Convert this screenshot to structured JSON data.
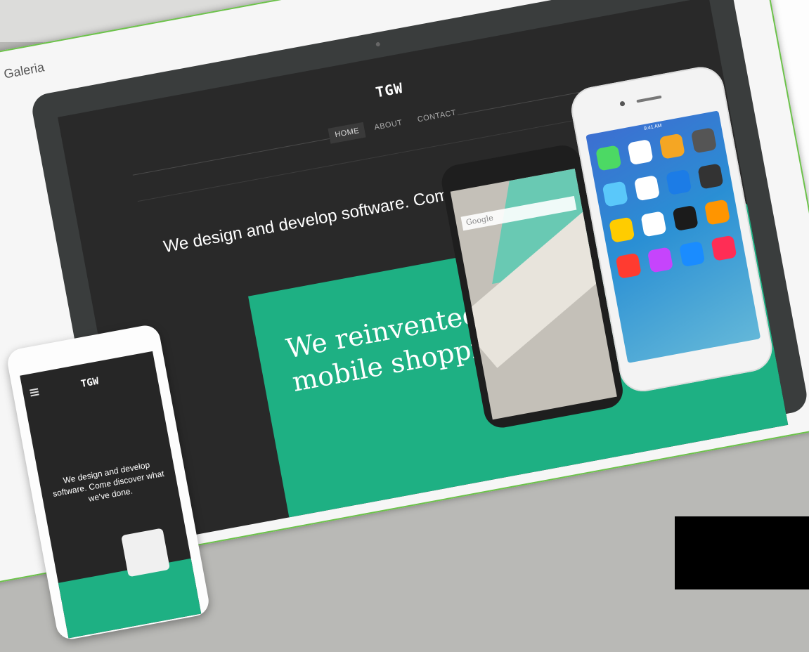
{
  "card": {
    "title": "Galeria"
  },
  "website": {
    "logo": "TGW",
    "nav": [
      {
        "label": "HOME",
        "active": true
      },
      {
        "label": "ABOUT",
        "active": false
      },
      {
        "label": "CONTACT",
        "active": false
      }
    ],
    "headline": "We design and develop software. Come discover what we've done.",
    "promo": "We reinvented\nmobile shopping.",
    "search_placeholder": "Google",
    "mobile_logo": "TGW",
    "mobile_tagline": "We design and develop software. Come discover what we've done."
  },
  "colors": {
    "accent_green": "#1eb083",
    "card_border": "#6cc24a",
    "site_background": "#292929"
  },
  "iphone": {
    "status_time": "9:41 AM",
    "app_colors": [
      "#4cd964",
      "#ffffff",
      "#f5a623",
      "#555555",
      "#5ac8fa",
      "#ffffff",
      "#1c7ce6",
      "#333333",
      "#ffcc00",
      "#ffffff",
      "#1b1b1b",
      "#ff9500",
      "#ff3b30",
      "#c644fc",
      "#1a8cff",
      "#ff2d55"
    ]
  }
}
